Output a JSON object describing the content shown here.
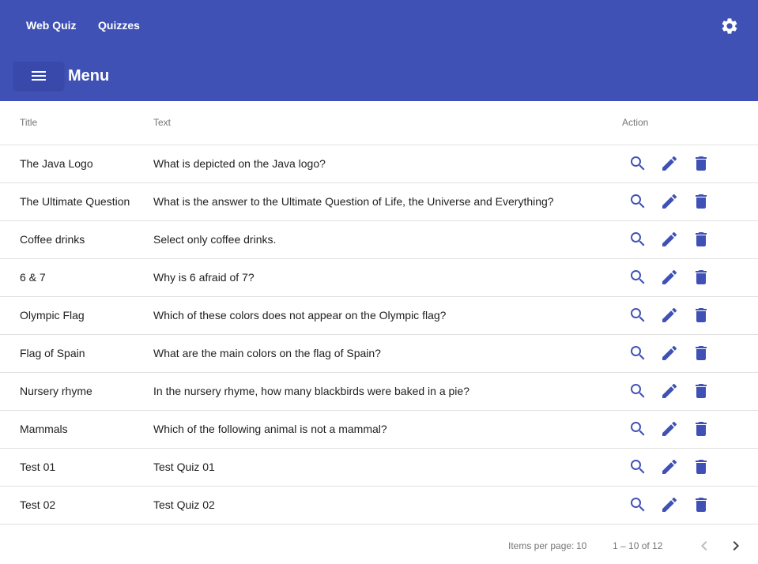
{
  "toolbar": {
    "nav": [
      {
        "label": "Web Quiz"
      },
      {
        "label": "Quizzes"
      }
    ],
    "settings_icon": "gear-icon",
    "menu_label": "Menu",
    "menu_icon": "hamburger-icon",
    "background_color": "#3f51b5"
  },
  "table": {
    "columns": [
      "Title",
      "Text",
      "Action"
    ],
    "action_icons": [
      "search-icon",
      "edit-icon",
      "delete-icon"
    ],
    "action_color": "#3f51b5",
    "rows": [
      {
        "title": "The Java Logo",
        "text": "What is depicted on the Java logo?"
      },
      {
        "title": "The Ultimate Question",
        "text": "What is the answer to the Ultimate Question of Life, the Universe and Everything?"
      },
      {
        "title": "Coffee drinks",
        "text": "Select only coffee drinks."
      },
      {
        "title": "6 & 7",
        "text": "Why is 6 afraid of 7?"
      },
      {
        "title": "Olympic Flag",
        "text": "Which of these colors does not appear on the Olympic flag?"
      },
      {
        "title": "Flag of Spain",
        "text": "What are the main colors on the flag of Spain?"
      },
      {
        "title": "Nursery rhyme",
        "text": "In the nursery rhyme, how many blackbirds were baked in a pie?"
      },
      {
        "title": "Mammals",
        "text": "Which of the following animal is not a mammal?"
      },
      {
        "title": "Test 01",
        "text": "Test Quiz 01"
      },
      {
        "title": "Test 02",
        "text": "Test Quiz 02"
      }
    ]
  },
  "paginator": {
    "items_per_page_label": "Items per page:",
    "page_size": "10",
    "range_label": "1 – 10 of 12",
    "prev_icon": "chevron-left-icon",
    "next_icon": "chevron-right-icon"
  }
}
